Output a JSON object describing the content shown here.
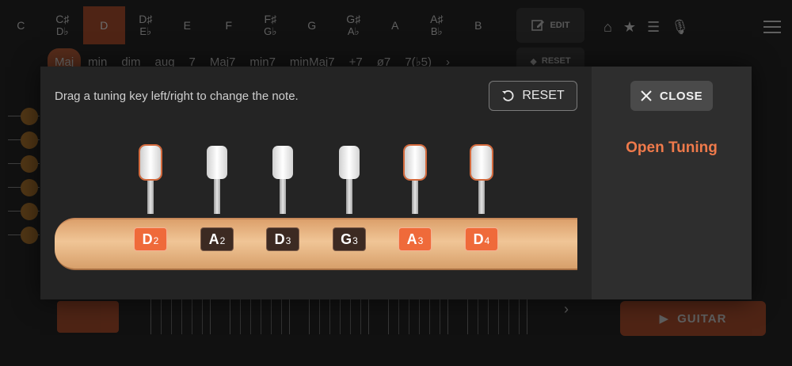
{
  "background": {
    "notes": [
      {
        "main": "C",
        "sub": ""
      },
      {
        "main": "C♯",
        "sub": "D♭"
      },
      {
        "main": "D",
        "sub": "",
        "active": true
      },
      {
        "main": "D♯",
        "sub": "E♭"
      },
      {
        "main": "E",
        "sub": ""
      },
      {
        "main": "F",
        "sub": ""
      },
      {
        "main": "F♯",
        "sub": "G♭"
      },
      {
        "main": "G",
        "sub": ""
      },
      {
        "main": "G♯",
        "sub": "A♭"
      },
      {
        "main": "A",
        "sub": ""
      },
      {
        "main": "A♯",
        "sub": "B♭"
      },
      {
        "main": "B",
        "sub": ""
      }
    ],
    "edit_label": "EDIT",
    "reset_label": "RESET",
    "chords": [
      "Maj",
      "min",
      "dim",
      "aug",
      "7",
      "Maj7",
      "min7",
      "minMaj7",
      "+7",
      "ø7",
      "7(♭5)"
    ],
    "guitar_label": "GUITAR",
    "icons": [
      "home-icon",
      "star-icon",
      "filter-icon",
      "mic-icon",
      "menu-icon"
    ]
  },
  "modal": {
    "instruction": "Drag a tuning key left/right to change the note.",
    "reset_label": "RESET",
    "close_label": "CLOSE",
    "tuning_name": "Open Tuning",
    "accent_color": "#ef7a4b",
    "pegs": [
      {
        "note": "D",
        "octave": "2",
        "highlight": true
      },
      {
        "note": "A",
        "octave": "2",
        "highlight": false
      },
      {
        "note": "D",
        "octave": "3",
        "highlight": false
      },
      {
        "note": "G",
        "octave": "3",
        "highlight": false
      },
      {
        "note": "A",
        "octave": "3",
        "highlight": true
      },
      {
        "note": "D",
        "octave": "4",
        "highlight": true
      }
    ]
  }
}
